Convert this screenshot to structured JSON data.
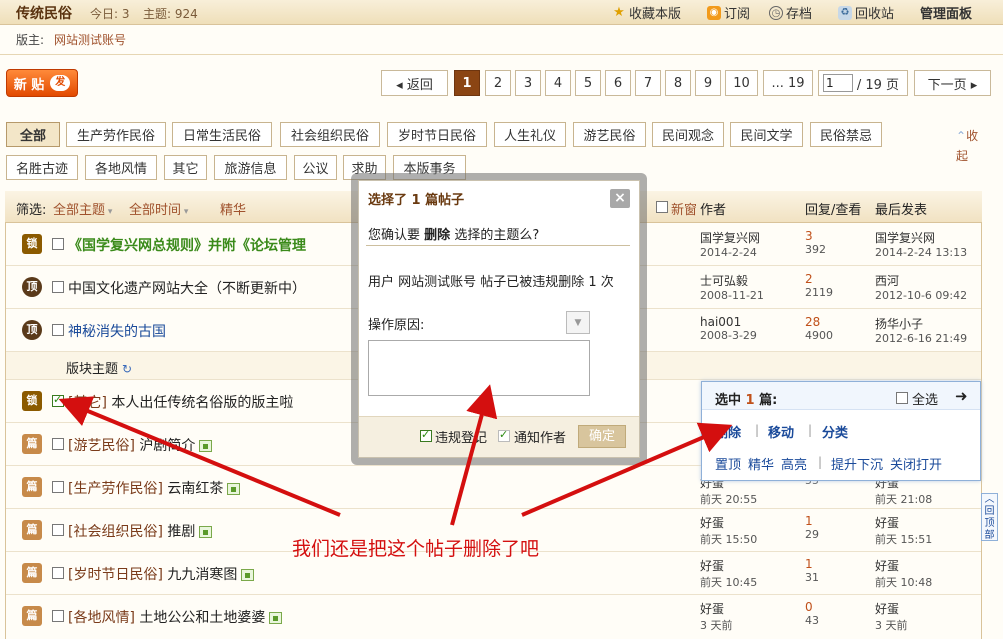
{
  "header": {
    "forum_name": "传统民俗",
    "today": "今日: 3",
    "topics": "主题: 924",
    "links": [
      "收藏本版",
      "订阅",
      "存档",
      "回收站",
      "管理面板"
    ],
    "moderator_label": "版主:",
    "moderator_name": "网站测试账号"
  },
  "toolbar": {
    "new_post": "新 贴",
    "new_post_icon": "发",
    "pager": {
      "back": "◂ 返回",
      "pages": [
        "1",
        "2",
        "3",
        "4",
        "5",
        "6",
        "7",
        "8",
        "9",
        "10"
      ],
      "ellipsis": "... 19",
      "current_input": "1",
      "total": "/ 19 页",
      "next": "下一页 ▸"
    }
  },
  "tags": {
    "row1": [
      "全部",
      "生产劳作民俗",
      "日常生活民俗",
      "社会组织民俗",
      "岁时节日民俗",
      "人生礼仪",
      "游艺民俗",
      "民间观念",
      "民间文学",
      "民俗禁忌"
    ],
    "row2": [
      "名胜古迹",
      "各地风情",
      "其它",
      "旅游信息",
      "公议",
      "求助",
      "本版事务"
    ],
    "collapse": "收起"
  },
  "table": {
    "filter_label": "筛选:",
    "filter_type": "全部主题",
    "filter_time": "全部时间",
    "filter_digest": "精华",
    "new_window": "新窗",
    "col_author": "作者",
    "col_replies": "回复/查看",
    "col_last": "最后发表",
    "section_label": "版块主题",
    "rows": [
      {
        "icon": "锁",
        "category": "",
        "title": "《国学复兴网总规则》并附《论坛管理",
        "author": "国学复兴网",
        "date": "2014-2-24",
        "replies": "3",
        "views": "392",
        "last_user": "国学复兴网",
        "last_date": "2014-2-24 13:13"
      },
      {
        "icon": "顶",
        "category": "",
        "title": "中国文化遗产网站大全（不断更新中）",
        "author": "士可弘毅",
        "date": "2008-11-21",
        "replies": "2",
        "views": "2119",
        "last_user": "西河",
        "last_date": "2012-10-6 09:42"
      },
      {
        "icon": "顶",
        "category": "",
        "title": "神秘消失的古国",
        "author": "hai001",
        "date": "2008-3-29",
        "replies": "28",
        "views": "4900",
        "last_user": "扬华小子",
        "last_date": "2012-6-16 21:49"
      },
      {
        "icon": "锁",
        "category": "[其它]",
        "title": "本人出任传统名俗版的版主啦",
        "author": "",
        "date": "",
        "replies": "",
        "views": "",
        "last_user": "",
        "last_date": ""
      },
      {
        "icon": "篇",
        "category": "[游艺民俗]",
        "title": "沪剧简介",
        "author": "",
        "date": "",
        "replies": "",
        "views": "",
        "last_user": "",
        "last_date": ""
      },
      {
        "icon": "篇",
        "category": "[生产劳作民俗]",
        "title": "云南红茶",
        "author": "好蛋",
        "date": "前天 20:55",
        "replies": "",
        "views": "55",
        "last_user": "好蛋",
        "last_date": "前天 21:08"
      },
      {
        "icon": "篇",
        "category": "[社会组织民俗]",
        "title": "推剧",
        "author": "好蛋",
        "date": "前天 15:50",
        "replies": "1",
        "views": "29",
        "last_user": "好蛋",
        "last_date": "前天 15:51"
      },
      {
        "icon": "篇",
        "category": "[岁时节日民俗]",
        "title": "九九消寒图",
        "author": "好蛋",
        "date": "前天 10:45",
        "replies": "1",
        "views": "31",
        "last_user": "好蛋",
        "last_date": "前天 10:48"
      },
      {
        "icon": "篇",
        "category": "[各地风情]",
        "title": "土地公公和土地婆婆",
        "author": "好蛋",
        "date": "3 天前",
        "replies": "0",
        "views": "43",
        "last_user": "好蛋",
        "last_date": "3 天前"
      }
    ]
  },
  "dialog": {
    "title": "选择了 1 篇帖子",
    "question_pre": "您确认要",
    "question_action": "删除",
    "question_post": "选择的主题么?",
    "user_notice": "用户 网站测试账号 帖子已被违规删除 1 次",
    "reason_label": "操作原因:",
    "checkbox_violation": "违规登记",
    "checkbox_notify": "通知作者",
    "confirm": "确定",
    "close": "×"
  },
  "selection_panel": {
    "title_pre": "选中",
    "count": "1",
    "title_post": "篇:",
    "select_all": "全选",
    "actions_row1": [
      "删除",
      "移动",
      "分类"
    ],
    "actions_row2": [
      "置顶",
      "精华",
      "高亮",
      "提升下沉",
      "关闭打开"
    ]
  },
  "annotation": "我们还是把这个帖子删除了吧",
  "back_to_top": "回顶部",
  "colors": {
    "brand": "#8b4513",
    "accent": "#e24a00",
    "annotation": "#d40f0f",
    "link_blue": "#1a4a9a"
  }
}
